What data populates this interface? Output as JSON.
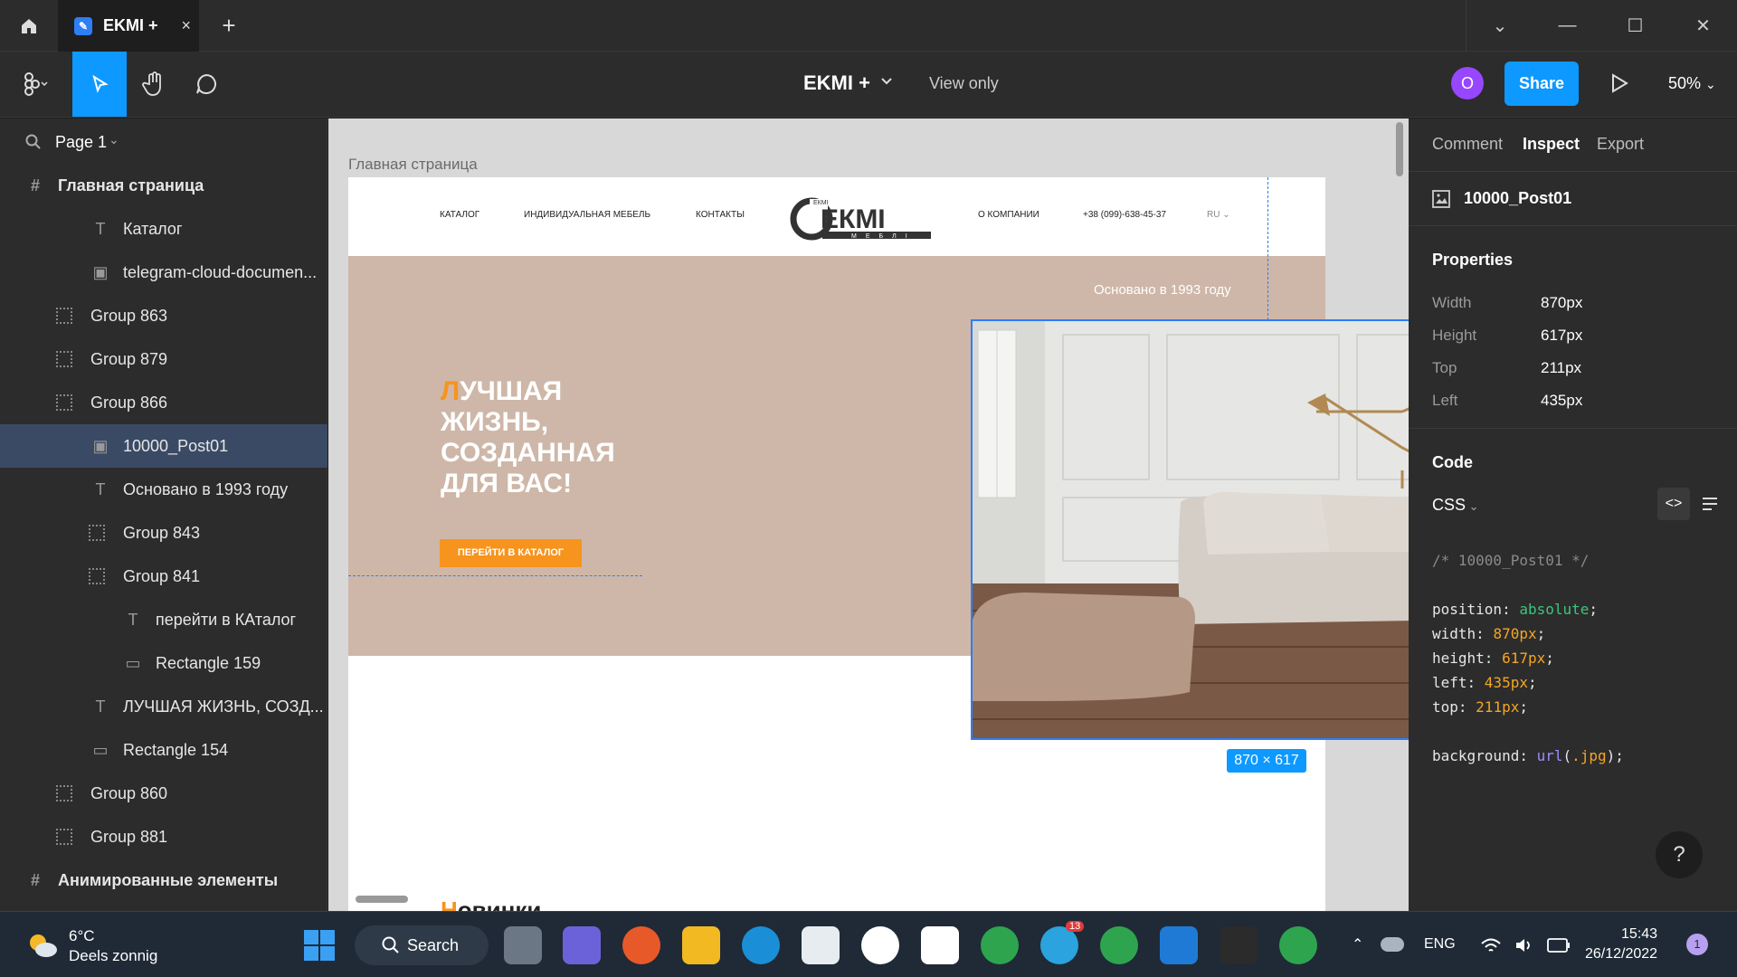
{
  "tab": {
    "title": "EKMI +",
    "close": "×",
    "new": "+"
  },
  "window": {
    "chevron": "⌄",
    "minimize": "—",
    "maximize": "☐",
    "close": "✕"
  },
  "toolbar": {
    "file_name": "EKMI +",
    "view_mode": "View only",
    "avatar_letter": "O",
    "share_label": "Share",
    "zoom": "50%"
  },
  "left_panel": {
    "page": "Page 1",
    "layers": [
      {
        "label": "Главная страница",
        "type": "frame",
        "indent": 0
      },
      {
        "label": "Каталог",
        "type": "text",
        "indent": 2
      },
      {
        "label": "telegram-cloud-documen...",
        "type": "image",
        "indent": 2
      },
      {
        "label": "Group 863",
        "type": "group",
        "indent": 1
      },
      {
        "label": "Group 879",
        "type": "group",
        "indent": 1
      },
      {
        "label": "Group 866",
        "type": "group",
        "indent": 1
      },
      {
        "label": "10000_Post01",
        "type": "image",
        "indent": 2,
        "selected": true
      },
      {
        "label": "Основано в 1993 году",
        "type": "text",
        "indent": 2
      },
      {
        "label": "Group 843",
        "type": "group",
        "indent": 2
      },
      {
        "label": "Group 841",
        "type": "group",
        "indent": 2
      },
      {
        "label": "перейти в КАталог",
        "type": "text",
        "indent": 3
      },
      {
        "label": "Rectangle 159",
        "type": "rect",
        "indent": 3
      },
      {
        "label": "ЛУЧШАЯ ЖИЗНЬ, СОЗД...",
        "type": "text",
        "indent": 2
      },
      {
        "label": "Rectangle 154",
        "type": "rect",
        "indent": 2
      },
      {
        "label": "Group 860",
        "type": "group",
        "indent": 1
      },
      {
        "label": "Group 881",
        "type": "group",
        "indent": 1
      },
      {
        "label": "Анимированные элементы",
        "type": "frame",
        "indent": 0
      }
    ]
  },
  "canvas": {
    "frame_label": "Главная страница",
    "nav": {
      "catalog": "КАТАЛОГ",
      "custom": "ИНДИВИДУАЛЬНАЯ МЕБЕЛЬ",
      "contacts": "КОНТАКТЫ",
      "about": "О КОМПАНИИ",
      "phone": "+38 (099)-638-45-37",
      "lang": "RU"
    },
    "logo": {
      "text": "ЕКМІ",
      "sub": "МЕБЛІ",
      "top": "ЕКМІ"
    },
    "founded": "Основано в 1993 году",
    "headline_first": "Л",
    "headline_rest": "УЧШАЯ ЖИЗНЬ, СОЗДАННАЯ ДЛЯ ВАС!",
    "cta": "ПЕРЕЙТИ В КАТАЛОГ",
    "dims": "870 × 617",
    "novinki_first": "Н",
    "novinki_rest": "овинки"
  },
  "right_panel": {
    "tabs": [
      "Comment",
      "Inspect",
      "Export"
    ],
    "layer_name": "10000_Post01",
    "properties_title": "Properties",
    "properties": [
      {
        "label": "Width",
        "value": "870px"
      },
      {
        "label": "Height",
        "value": "617px"
      },
      {
        "label": "Top",
        "value": "211px"
      },
      {
        "label": "Left",
        "value": "435px"
      }
    ],
    "code_title": "Code",
    "code_lang": "CSS",
    "code_comment": "/* 10000_Post01 */",
    "code": {
      "position_k": "position",
      "position_v": "absolute",
      "width_k": "width",
      "width_v": "870px",
      "height_k": "height",
      "height_v": "617px",
      "left_k": "left",
      "left_v": "435px",
      "top_k": "top",
      "top_v": "211px",
      "bg_k": "background",
      "bg_fn": "url",
      "bg_arg": ".jpg"
    },
    "help": "?"
  },
  "taskbar": {
    "temp": "6°C",
    "weather": "Deels zonnig",
    "search": "Search",
    "lang": "ENG",
    "time": "15:43",
    "date": "26/12/2022",
    "telegram_badge": "13",
    "notif_badge": "1"
  }
}
